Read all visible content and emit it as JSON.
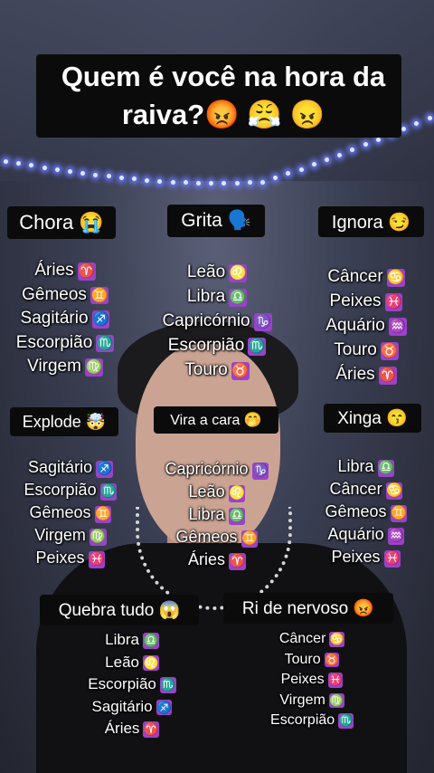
{
  "title": "Quem é você na hora da raiva?😡 😤 😠",
  "groups": {
    "chora": {
      "label": "Chora 😭",
      "signs": [
        [
          "Áries",
          "♈"
        ],
        [
          "Gêmeos",
          "♊"
        ],
        [
          "Sagitário",
          "♐"
        ],
        [
          "Escorpião",
          "♏"
        ],
        [
          "Virgem",
          "♍"
        ]
      ]
    },
    "grita": {
      "label": "Grita 🗣️",
      "signs": [
        [
          "Leão",
          "♌"
        ],
        [
          "Libra",
          "♎"
        ],
        [
          "Capricórnio",
          "♑"
        ],
        [
          "Escorpião",
          "♏"
        ],
        [
          "Touro",
          "♉"
        ]
      ]
    },
    "ignora": {
      "label": "Ignora 😏",
      "signs": [
        [
          "Câncer",
          "♋"
        ],
        [
          "Peixes",
          "♓"
        ],
        [
          "Aquário",
          "♒"
        ],
        [
          "Touro",
          "♉"
        ],
        [
          "Áries",
          "♈"
        ]
      ]
    },
    "explode": {
      "label": "Explode 🤯",
      "signs": [
        [
          "Sagitário",
          "♐"
        ],
        [
          "Escorpião",
          "♏"
        ],
        [
          "Gêmeos",
          "♊"
        ],
        [
          "Virgem",
          "♍"
        ],
        [
          "Peixes",
          "♓"
        ]
      ]
    },
    "vira": {
      "label": "Vira a cara 🤭",
      "signs": [
        [
          "Capricórnio",
          "♑"
        ],
        [
          "Leão",
          "♌"
        ],
        [
          "Libra",
          "♎"
        ],
        [
          "Gêmeos",
          "♊"
        ],
        [
          "Áries",
          "♈"
        ]
      ]
    },
    "xinga": {
      "label": "Xinga 😙",
      "signs": [
        [
          "Libra",
          "♎"
        ],
        [
          "Câncer",
          "♋"
        ],
        [
          "Gêmeos",
          "♊"
        ],
        [
          "Aquário",
          "♒"
        ],
        [
          "Peixes",
          "♓"
        ]
      ]
    },
    "quebra": {
      "label": "Quebra tudo 😱",
      "signs": [
        [
          "Libra",
          "♎"
        ],
        [
          "Leão",
          "♌"
        ],
        [
          "Escorpião",
          "♏"
        ],
        [
          "Sagitário",
          "♐"
        ],
        [
          "Áries",
          "♈"
        ]
      ]
    },
    "ri": {
      "label": "Ri de nervoso 😡",
      "signs": [
        [
          "Câncer",
          "♋"
        ],
        [
          "Touro",
          "♉"
        ],
        [
          "Peixes",
          "♓"
        ],
        [
          "Virgem",
          "♍"
        ],
        [
          "Escorpião",
          "♏"
        ]
      ]
    }
  }
}
